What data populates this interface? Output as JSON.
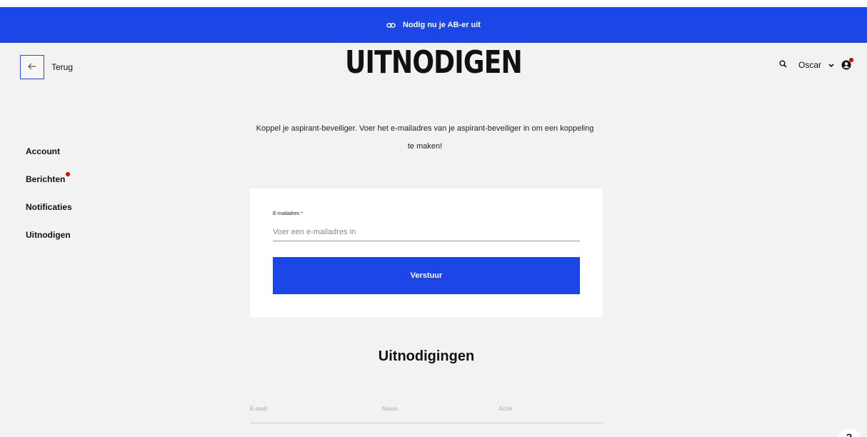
{
  "banner": {
    "text": "Nodig nu je AB-er uit",
    "icon": "link-icon",
    "color": "#1c46e6"
  },
  "header": {
    "back_label": "Terug",
    "title": "UITNODIGEN",
    "user_name": "Oscar",
    "icons": [
      "arrow-left-icon",
      "search-icon",
      "chevron-down-icon",
      "user-icon"
    ]
  },
  "sidebar": {
    "items": [
      {
        "label": "Account",
        "badge": false
      },
      {
        "label": "Berichten",
        "badge": true
      },
      {
        "label": "Notificaties",
        "badge": false
      },
      {
        "label": "Uitnodigen",
        "badge": false
      }
    ]
  },
  "main": {
    "intro_line1": "Koppel je aspirant-beveiliger. Voer het e-mailadres van je aspirant-beveiliger in om een koppeling",
    "intro_line2": "te maken!",
    "form": {
      "email_label": "E-mailadres *",
      "email_placeholder": "Voer een e-mailadres in",
      "email_value": "",
      "submit_label": "Verstuur"
    },
    "invitations": {
      "title": "Uitnodigingen",
      "columns": [
        "E-mail",
        "Naam",
        "Actie"
      ]
    }
  },
  "help": {
    "label": "?"
  },
  "colors": {
    "accent": "#1c46e6",
    "badge": "#e00000",
    "background": "#f2f2f2"
  }
}
